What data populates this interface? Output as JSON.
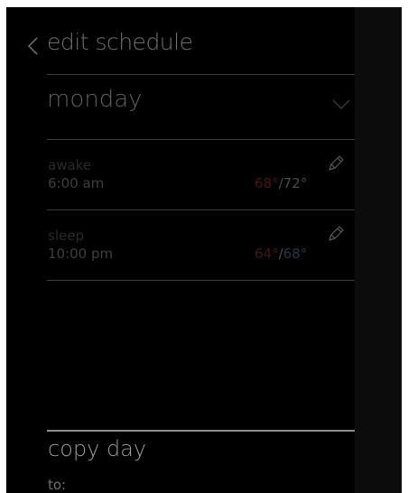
{
  "header": {
    "back_icon": "chevron-left-icon",
    "title": "edit schedule"
  },
  "day_selector": {
    "selected_day": "monday",
    "icon": "chevron-down-icon"
  },
  "periods": [
    {
      "name": "awake",
      "time": "6:00 am",
      "heat_temp": "68°",
      "separator": "/",
      "cool_temp": "72°",
      "edit_icon": "pencil-icon"
    },
    {
      "name": "sleep",
      "time": "10:00 pm",
      "heat_temp": "64°",
      "separator": "/",
      "cool_temp": "68°",
      "edit_icon": "pencil-icon"
    }
  ],
  "copy_day": {
    "title": "copy day",
    "to_label": "to:"
  },
  "colors": {
    "background": "#000000",
    "heat": "#4a1414",
    "cool": "#1c3a50",
    "text_dim": "#3e3e3e",
    "text_bright": "#9b9b9b"
  }
}
